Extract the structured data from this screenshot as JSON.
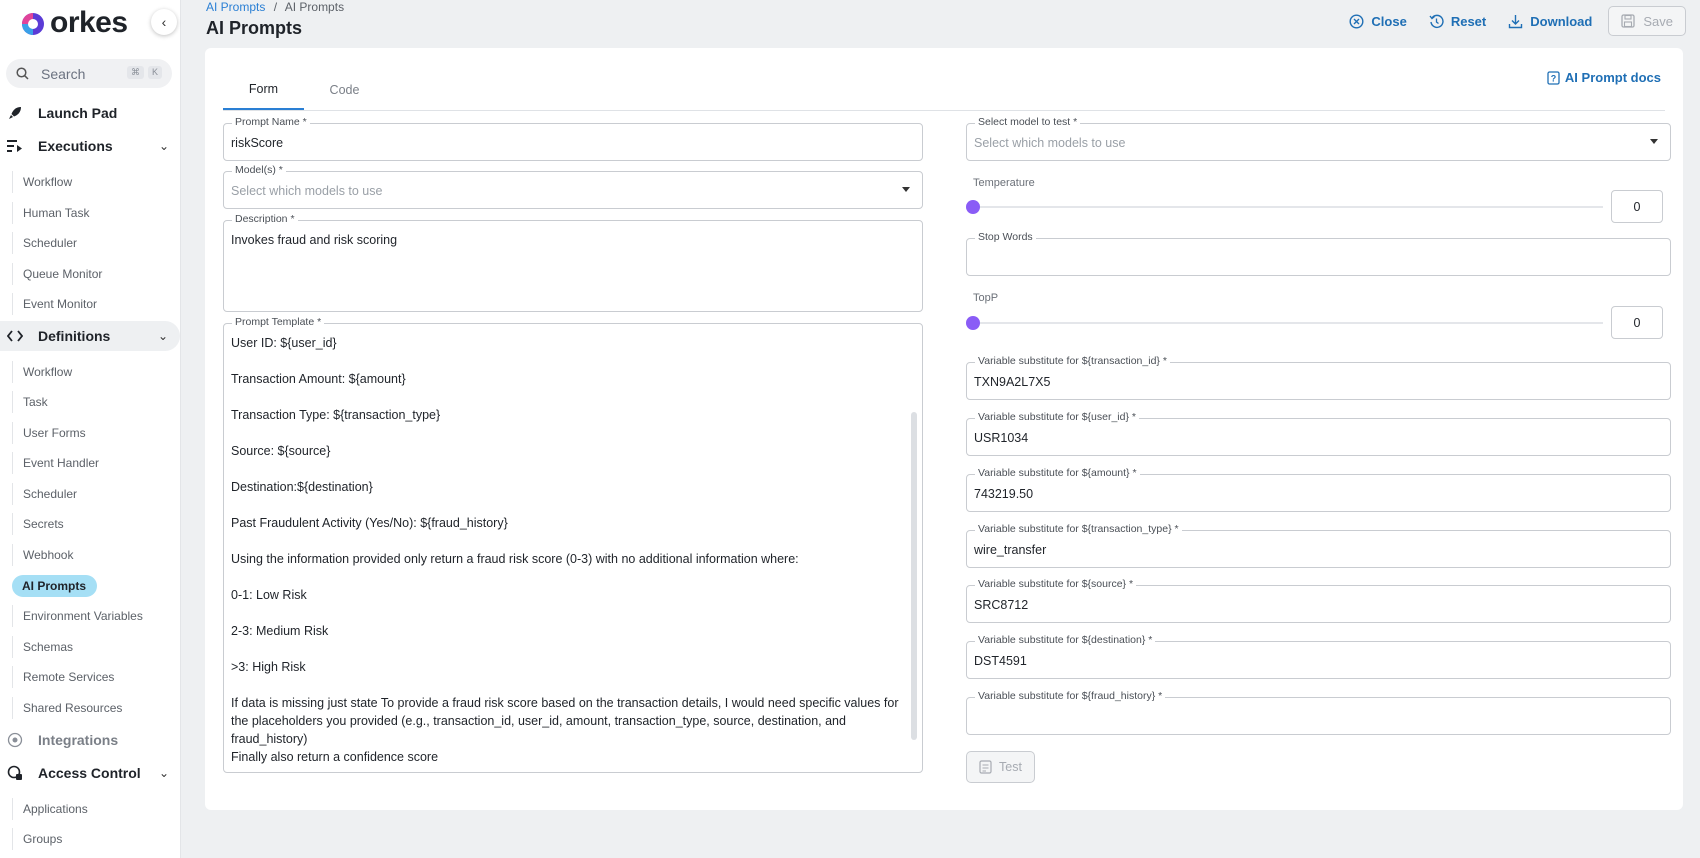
{
  "brand": {
    "name": "orkes"
  },
  "search": {
    "placeholder": "Search",
    "key1": "⌘",
    "key2": "K"
  },
  "sidebar": {
    "launch_pad": "Launch Pad",
    "executions": {
      "label": "Executions",
      "items": [
        "Workflow",
        "Human Task",
        "Scheduler",
        "Queue Monitor",
        "Event Monitor"
      ]
    },
    "definitions": {
      "label": "Definitions",
      "items": [
        "Workflow",
        "Task",
        "User Forms",
        "Event Handler",
        "Scheduler",
        "Secrets",
        "Webhook",
        "AI Prompts",
        "Environment Variables",
        "Schemas",
        "Remote Services",
        "Shared Resources"
      ]
    },
    "integrations": "Integrations",
    "access_control": {
      "label": "Access Control",
      "items": [
        "Applications",
        "Groups"
      ]
    }
  },
  "header": {
    "breadcrumb_link": "AI Prompts",
    "breadcrumb_sep": "/",
    "breadcrumb_current": "AI Prompts",
    "title": "AI Prompts",
    "close": "Close",
    "reset": "Reset",
    "download": "Download",
    "save": "Save"
  },
  "tabs": {
    "form": "Form",
    "code": "Code"
  },
  "docs_link": "AI Prompt docs",
  "form": {
    "prompt_name_label": "Prompt Name *",
    "prompt_name_value": "riskScore",
    "models_label": "Model(s) *",
    "models_placeholder": "Select which models to use",
    "description_label": "Description *",
    "description_value": "Invokes fraud and risk scoring",
    "template_label": "Prompt Template *",
    "template_lines": [
      "User ID: ${user_id}",
      "Transaction Amount: ${amount}",
      "Transaction Type: ${transaction_type}",
      "Source: ${source}",
      "Destination:${destination}",
      "Past Fraudulent Activity (Yes/No): ${fraud_history}",
      "Using the information provided only return a fraud risk score (0-3) with no additional information where:",
      "0-1: Low Risk",
      "2-3: Medium Risk",
      ">3: High Risk"
    ],
    "template_tail_1": "If data is missing just state To provide a fraud risk score based on the transaction details, I would need specific values for the placeholders you provided (e.g., transaction_id, user_id, amount, transaction_type, source, destination, and fraud_history)",
    "template_tail_2": "Finally also return a confidence score"
  },
  "test_panel": {
    "model_label": "Select model to test *",
    "model_placeholder": "Select which models to use",
    "temperature_label": "Temperature",
    "temperature_value": "0",
    "stop_words_label": "Stop Words",
    "topp_label": "TopP",
    "topp_value": "0",
    "variables": [
      {
        "label": "Variable substitute for ${transaction_id} *",
        "value": "TXN9A2L7X5"
      },
      {
        "label": "Variable substitute for ${user_id} *",
        "value": "USR1034"
      },
      {
        "label": "Variable substitute for ${amount} *",
        "value": "743219.50"
      },
      {
        "label": "Variable substitute for ${transaction_type} *",
        "value": "wire_transfer"
      },
      {
        "label": "Variable substitute for ${source} *",
        "value": "SRC8712"
      },
      {
        "label": "Variable substitute for ${destination} *",
        "value": "DST4591"
      },
      {
        "label": "Variable substitute for ${fraud_history} *",
        "value": ""
      }
    ],
    "test_button": "Test"
  },
  "colors": {
    "accent": "#1f6fb5",
    "active_nav": "#a5dff5",
    "slider_thumb": "#8a5cf6"
  }
}
